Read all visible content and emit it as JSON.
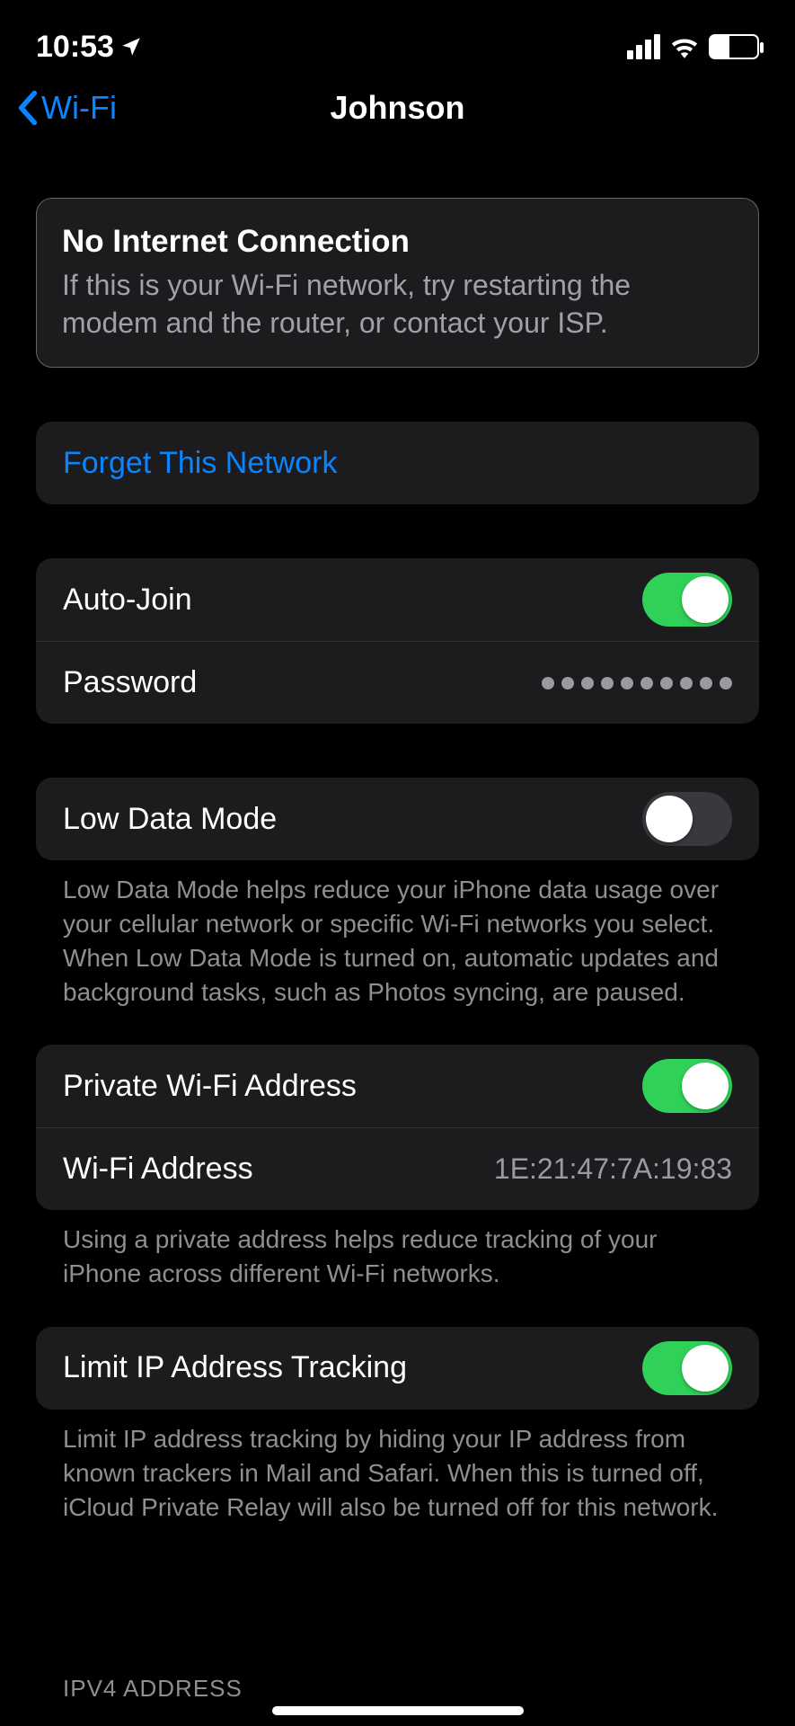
{
  "status": {
    "time": "10:53"
  },
  "nav": {
    "back": "Wi-Fi",
    "title": "Johnson"
  },
  "alert": {
    "title": "No Internet Connection",
    "body": "If this is your Wi-Fi network, try restarting the modem and the router, or contact your ISP."
  },
  "actions": {
    "forget": "Forget This Network"
  },
  "network": {
    "auto_join_label": "Auto-Join",
    "auto_join_on": true,
    "password_label": "Password",
    "password_dots": 10
  },
  "low_data": {
    "label": "Low Data Mode",
    "on": false,
    "footer": "Low Data Mode helps reduce your iPhone data usage over your cellular network or specific Wi-Fi networks you select. When Low Data Mode is turned on, automatic updates and background tasks, such as Photos syncing, are paused."
  },
  "private_addr": {
    "toggle_label": "Private Wi-Fi Address",
    "toggle_on": true,
    "addr_label": "Wi-Fi Address",
    "addr_value": "1E:21:47:7A:19:83",
    "footer": "Using a private address helps reduce tracking of your iPhone across different Wi-Fi networks."
  },
  "limit_ip": {
    "label": "Limit IP Address Tracking",
    "on": true,
    "footer": "Limit IP address tracking by hiding your IP address from known trackers in Mail and Safari. When this is turned off, iCloud Private Relay will also be turned off for this network."
  },
  "ipv4_header": "IPV4 ADDRESS"
}
